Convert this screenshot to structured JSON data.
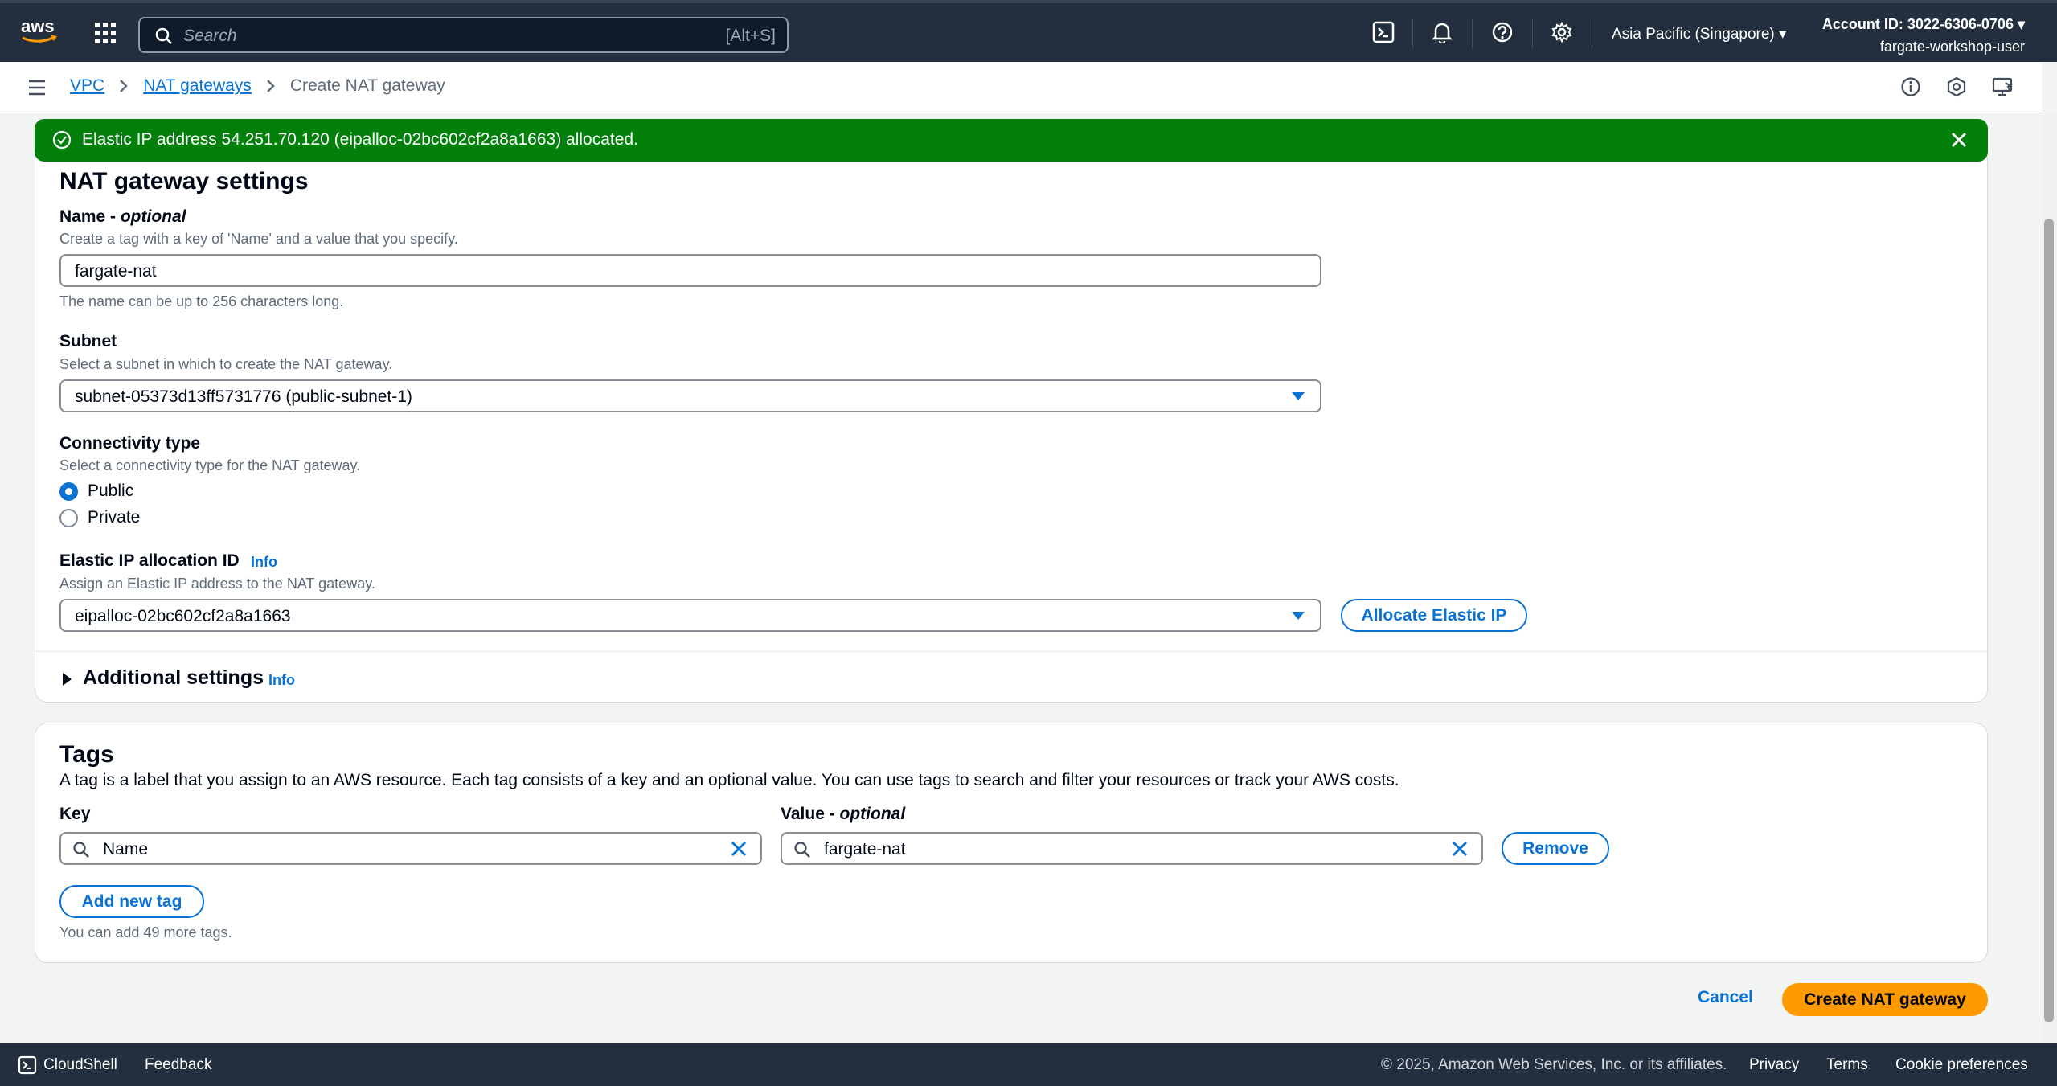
{
  "topnav": {
    "logo_text": "aws",
    "search_placeholder": "Search",
    "search_shortcut": "[Alt+S]",
    "region": "Asia Pacific (Singapore) ▾",
    "account_id": "Account ID: 3022-6306-0706 ▾",
    "user": "fargate-workshop-user",
    "icons": [
      "cloudshell-icon",
      "bell-icon",
      "help-icon",
      "gear-icon"
    ]
  },
  "breadcrumb": {
    "items": [
      "VPC",
      "NAT gateways"
    ],
    "current": "Create NAT gateway"
  },
  "flash": {
    "message": "Elastic IP address 54.251.70.120 (eipalloc-02bc602cf2a8a1663) allocated.",
    "color": "#037f0c"
  },
  "settings": {
    "title": "NAT gateway settings",
    "name": {
      "label": "Name - ",
      "label_optional": "optional",
      "description": "Create a tag with a key of 'Name' and a value that you specify.",
      "value": "fargate-nat",
      "constraint": "The name can be up to 256 characters long."
    },
    "subnet": {
      "label": "Subnet",
      "description": "Select a subnet in which to create the NAT gateway.",
      "value": "subnet-05373d13ff5731776 (public-subnet-1)"
    },
    "connectivity": {
      "label": "Connectivity type",
      "description": "Select a connectivity type for the NAT gateway.",
      "options": [
        "Public",
        "Private"
      ],
      "selected": "Public"
    },
    "eip": {
      "label": "Elastic IP allocation ID",
      "info": "Info",
      "description": "Assign an Elastic IP address to the NAT gateway.",
      "value": "eipalloc-02bc602cf2a8a1663",
      "allocate_button": "Allocate Elastic IP"
    },
    "additional": {
      "label": "Additional settings",
      "info": "Info"
    }
  },
  "tags": {
    "title": "Tags",
    "description": "A tag is a label that you assign to an AWS resource. Each tag consists of a key and an optional value. You can use tags to search and filter your resources or track your AWS costs.",
    "key_label": "Key",
    "value_label": "Value - ",
    "value_label_optional": "optional",
    "key_value": "Name",
    "value_value": "fargate-nat",
    "remove_button": "Remove",
    "add_button": "Add new tag",
    "remaining": "You can add 49 more tags."
  },
  "actions": {
    "cancel": "Cancel",
    "create": "Create NAT gateway",
    "create_color": "#ff9900"
  },
  "footer": {
    "cloudshell": "CloudShell",
    "feedback": "Feedback",
    "copyright": "© 2025, Amazon Web Services, Inc. or its affiliates.",
    "privacy": "Privacy",
    "terms": "Terms",
    "cookies": "Cookie preferences"
  }
}
